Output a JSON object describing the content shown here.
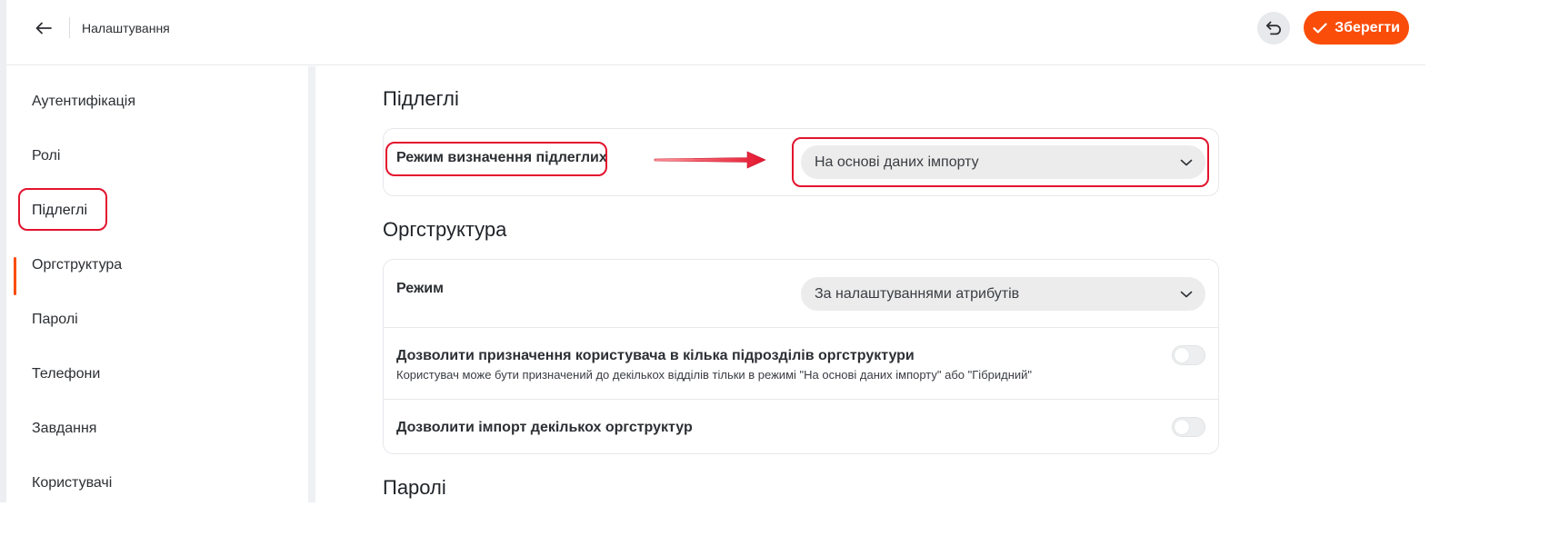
{
  "header": {
    "title": "Налаштування",
    "save_label": "Зберегти"
  },
  "sidebar": {
    "items": [
      {
        "label": "Аутентифікація"
      },
      {
        "label": "Ролі"
      },
      {
        "label": "Підлеглі",
        "active": true
      },
      {
        "label": "Оргструктура"
      },
      {
        "label": "Паролі"
      },
      {
        "label": "Телефони"
      },
      {
        "label": "Завдання"
      },
      {
        "label": "Користувачі"
      }
    ]
  },
  "sections": {
    "subordinates": {
      "title": "Підлеглі",
      "mode_label": "Режим визначення підлеглих",
      "mode_value": "На основі даних імпорту"
    },
    "orgstructure": {
      "title": "Оргструктура",
      "mode_label": "Режим",
      "mode_value": "За налаштуваннями атрибутів",
      "multi_assign_label": "Дозволити призначення користувача в кілька підрозділів оргструктури",
      "multi_assign_desc": "Користувач може бути призначений до декількох відділів тільки в режимі \"На основі даних імпорту\" або \"Гібридний\"",
      "multi_assign_on": false,
      "multi_import_label": "Дозволити імпорт декількох оргструктур",
      "multi_import_on": false
    },
    "passwords": {
      "title": "Паролі"
    }
  },
  "colors": {
    "accent": "#fa4d0a",
    "annotation": "#e3142e"
  },
  "icons": {
    "back": "arrow-left-icon",
    "undo": "undo-icon",
    "save": "check-icon",
    "select": "chevron-down-icon"
  }
}
